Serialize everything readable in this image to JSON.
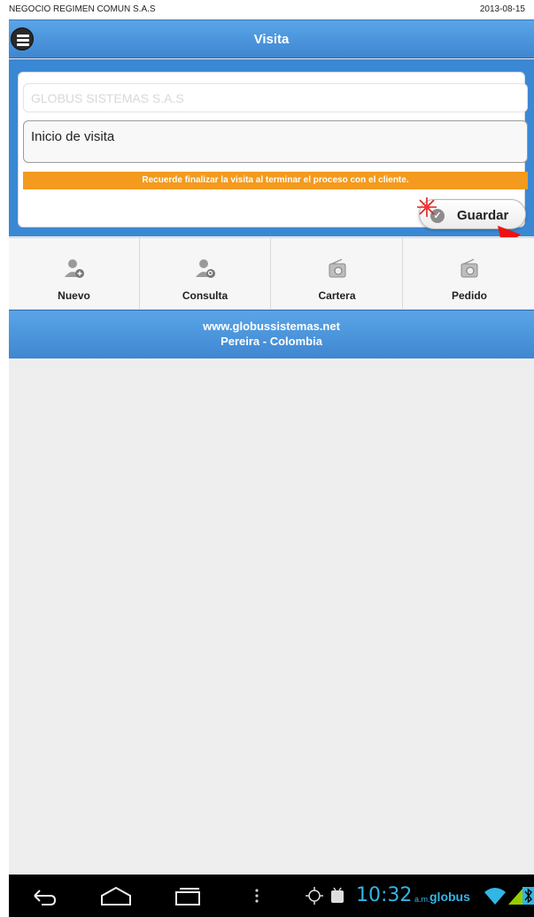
{
  "status": {
    "company": "NEGOCIO REGIMEN COMUN S.A.S",
    "date": "2013-08-15"
  },
  "header": {
    "title": "Visita"
  },
  "form": {
    "client_placeholder": "GLOBUS SISTEMAS S.A.S",
    "observation_value": "Inicio de visita",
    "reminder": "Recuerde finalizar la visita al terminar el proceso con el cliente.",
    "save_label": "Guardar"
  },
  "tabs": [
    {
      "label": "Nuevo",
      "icon": "person-add-icon"
    },
    {
      "label": "Consulta",
      "icon": "person-search-icon"
    },
    {
      "label": "Cartera",
      "icon": "radio-icon"
    },
    {
      "label": "Pedido",
      "icon": "radio-icon"
    }
  ],
  "footer": {
    "website": "www.globussistemas.net",
    "location": "Pereira - Colombia"
  },
  "system_bar": {
    "time": "10:32",
    "ampm": "a.m.",
    "carrier": "globus"
  },
  "colors": {
    "header_blue": "#3f86d1",
    "accent_orange": "#f49a1e",
    "system_blue": "#33b5e5"
  }
}
